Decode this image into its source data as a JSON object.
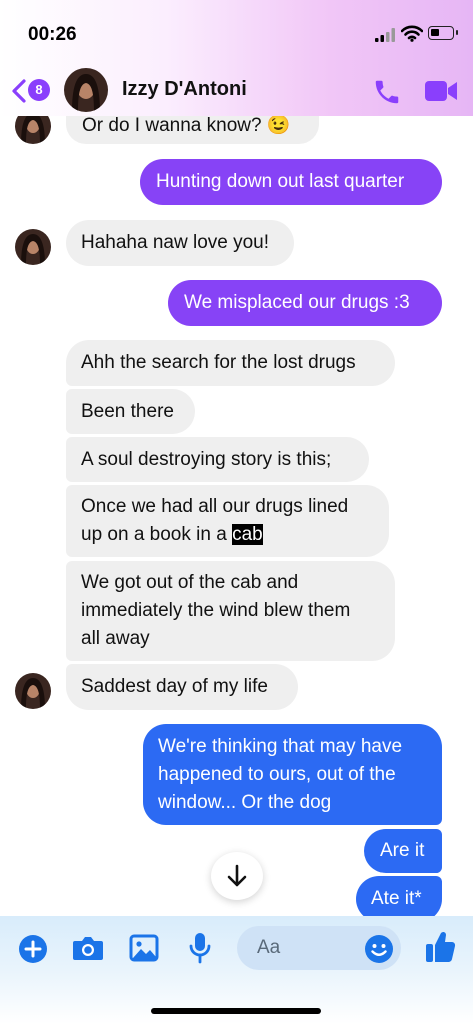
{
  "status": {
    "time": "00:26"
  },
  "header": {
    "badge_count": "8",
    "contact_name": "Izzy D'Antoni"
  },
  "messages": {
    "m0": "Or do I wanna know? 😉",
    "m1": "Hunting down out last quarter",
    "m2": "Hahaha naw love you!",
    "m3": "We misplaced our drugs :3",
    "m4": "Ahh the search for the lost drugs",
    "m5": "Been there",
    "m6": "A soul destroying story is this;",
    "m7a": "Once we had all our drugs lined",
    "m7b": "up on a book in a ",
    "m7c": "cab",
    "m8a": "We got out of the cab and",
    "m8b": "immediately the wind blew them",
    "m8c": "all away",
    "m9": "Saddest day of my life",
    "m10a": "We're thinking that may have",
    "m10b": "happened to ours, out of the",
    "m10c": "window... Or the dog",
    "m11": "Are it",
    "m12": "Ate it*"
  },
  "composer": {
    "placeholder": "Aa"
  },
  "icons": {
    "back": "chevron-left-icon",
    "phone": "phone-icon",
    "video": "video-camera-icon",
    "plus": "plus-circle-icon",
    "camera": "camera-icon",
    "gallery": "image-icon",
    "mic": "microphone-icon",
    "emoji": "smiley-icon",
    "like": "thumbs-up-icon",
    "scroll": "arrow-down-icon"
  },
  "colors": {
    "accent": "#8a3ffc",
    "outgoing_purple": "#8743f6",
    "outgoing_blue": "#2c6af3",
    "incoming": "#efefef",
    "icon_blue": "#1b74e8"
  }
}
